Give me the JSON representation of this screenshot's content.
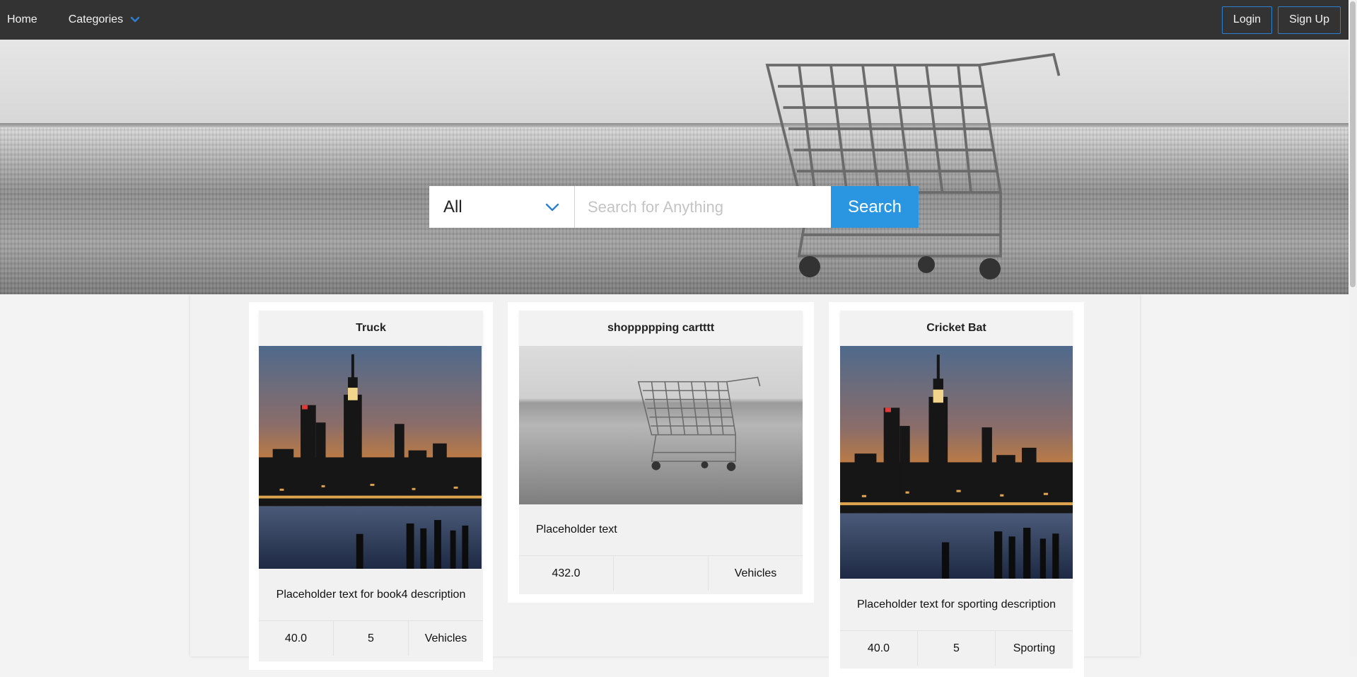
{
  "navbar": {
    "home_label": "Home",
    "categories_label": "Categories",
    "login_label": "Login",
    "signup_label": "Sign Up",
    "accent_color": "#2d7fd3"
  },
  "hero": {
    "background_icon": "shopping-cart-photo",
    "search": {
      "category_selected": "All",
      "placeholder": "Search for Anything",
      "button_label": "Search",
      "button_color": "#2a96e2"
    }
  },
  "products": [
    {
      "title": "Truck",
      "image": "city-skyline-photo",
      "description": "Placeholder text for book4 description",
      "price": "40.0",
      "quantity": "5",
      "category": "Vehicles"
    },
    {
      "title": "shoppppping cartttt",
      "image": "shopping-cart-photo",
      "description": "Placeholder text",
      "price": "432.0",
      "quantity": "",
      "category": "Vehicles"
    },
    {
      "title": "Cricket Bat",
      "image": "city-skyline-photo",
      "description": "Placeholder text for sporting description",
      "price": "40.0",
      "quantity": "5",
      "category": "Sporting"
    }
  ]
}
